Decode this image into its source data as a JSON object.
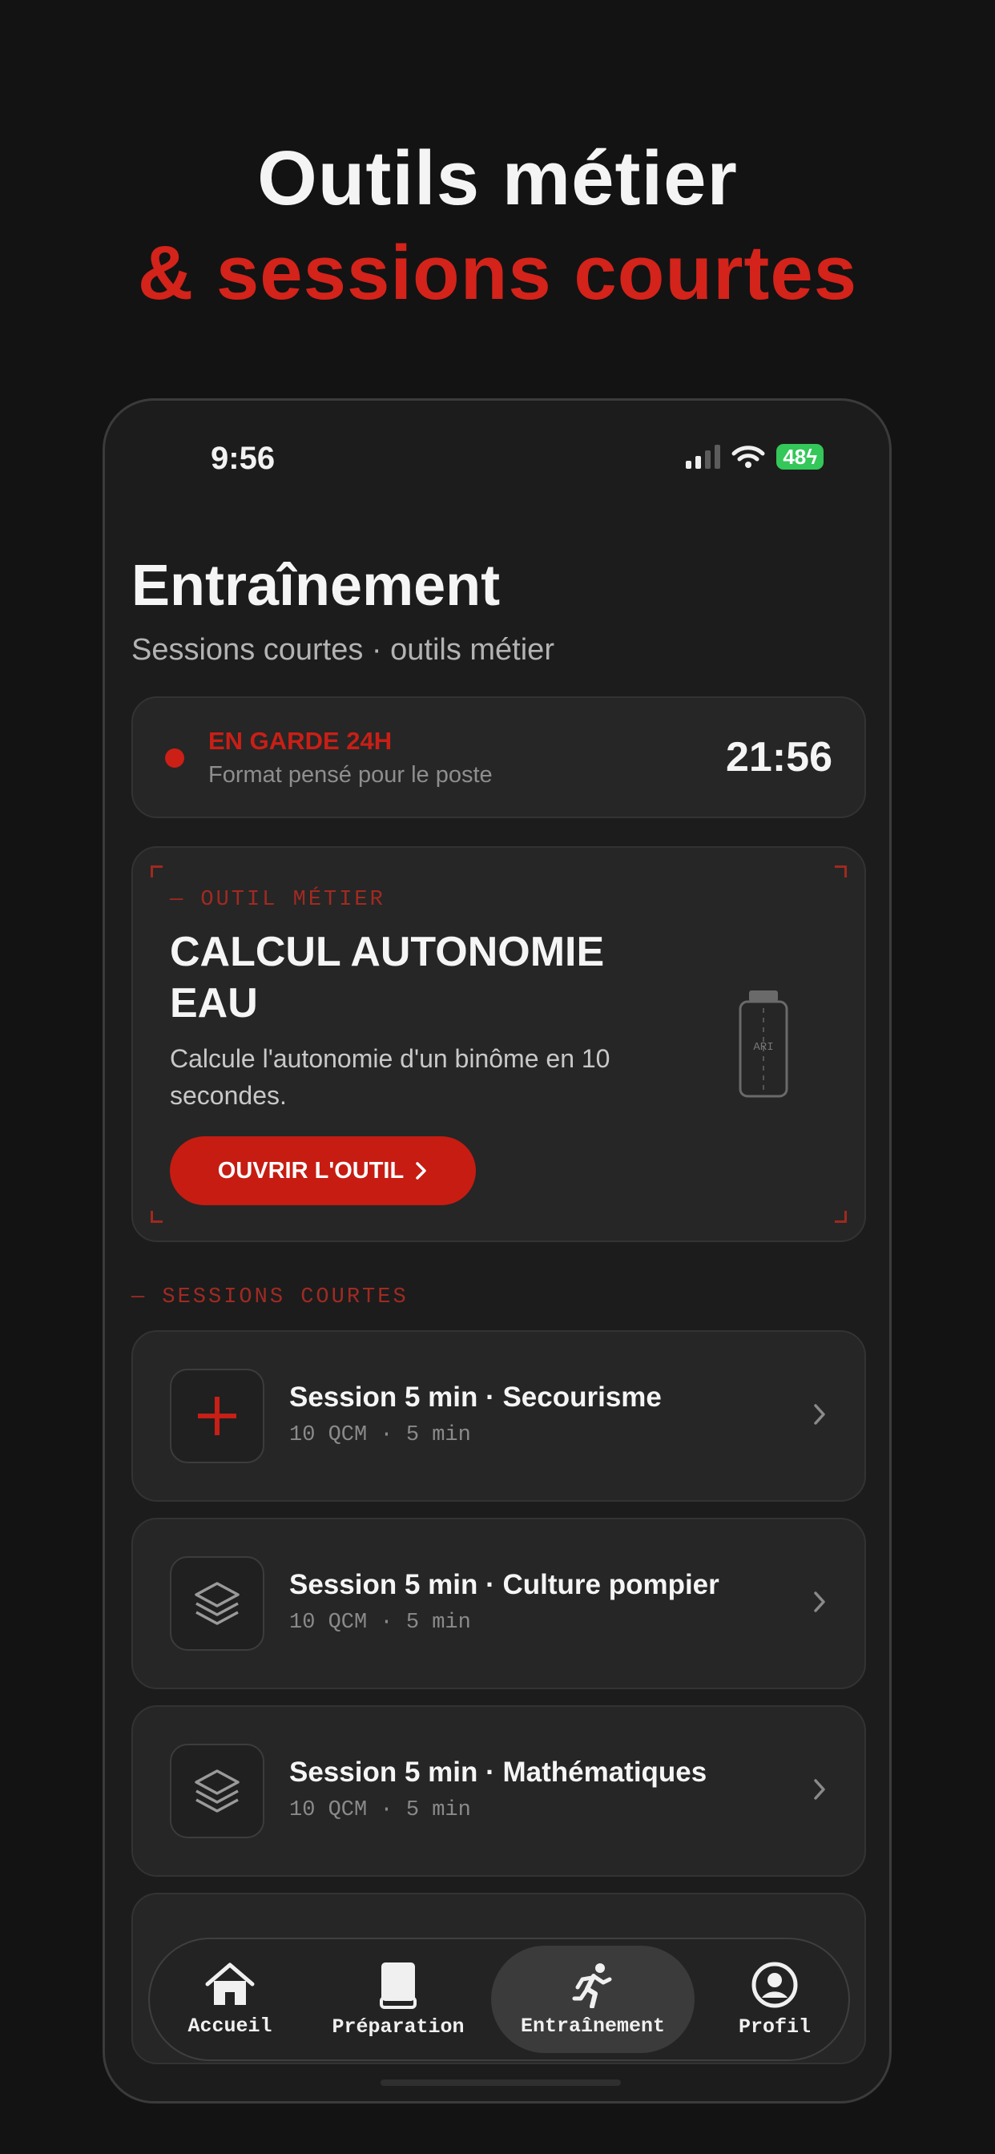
{
  "promo": {
    "line1": "Outils métier",
    "line2": "& sessions courtes"
  },
  "status_bar": {
    "time": "9:56",
    "battery": "48"
  },
  "header": {
    "title": "Entraînement",
    "subtitle": "Sessions courtes · outils métier"
  },
  "duty": {
    "title": "EN GARDE 24H",
    "subtitle": "Format pensé pour le poste",
    "time": "21:56"
  },
  "tool": {
    "kicker": "— OUTIL MÉTIER",
    "title": "CALCUL AUTONOMIE EAU",
    "description": "Calcule l'autonomie d'un binôme en 10 secondes.",
    "button_label": "OUVRIR L'OUTIL",
    "illustration_label": "ARI"
  },
  "sessions_label": "— SESSIONS COURTES",
  "sessions": [
    {
      "title": "Session 5 min · Secourisme",
      "meta": "10 QCM · 5 min",
      "icon": "plus-icon"
    },
    {
      "title": "Session 5 min · Culture pompier",
      "meta": "10 QCM · 5 min",
      "icon": "layers-icon"
    },
    {
      "title": "Session 5 min · Mathématiques",
      "meta": "10 QCM · 5 min",
      "icon": "layers-icon"
    }
  ],
  "tabs": [
    {
      "label": "Accueil",
      "icon": "home-icon"
    },
    {
      "label": "Préparation",
      "icon": "book-icon"
    },
    {
      "label": "Entraînement",
      "icon": "runner-icon",
      "active": true
    },
    {
      "label": "Profil",
      "icon": "profile-icon"
    }
  ],
  "colors": {
    "accent": "#c61c12",
    "background": "#131313",
    "card": "#262626"
  }
}
